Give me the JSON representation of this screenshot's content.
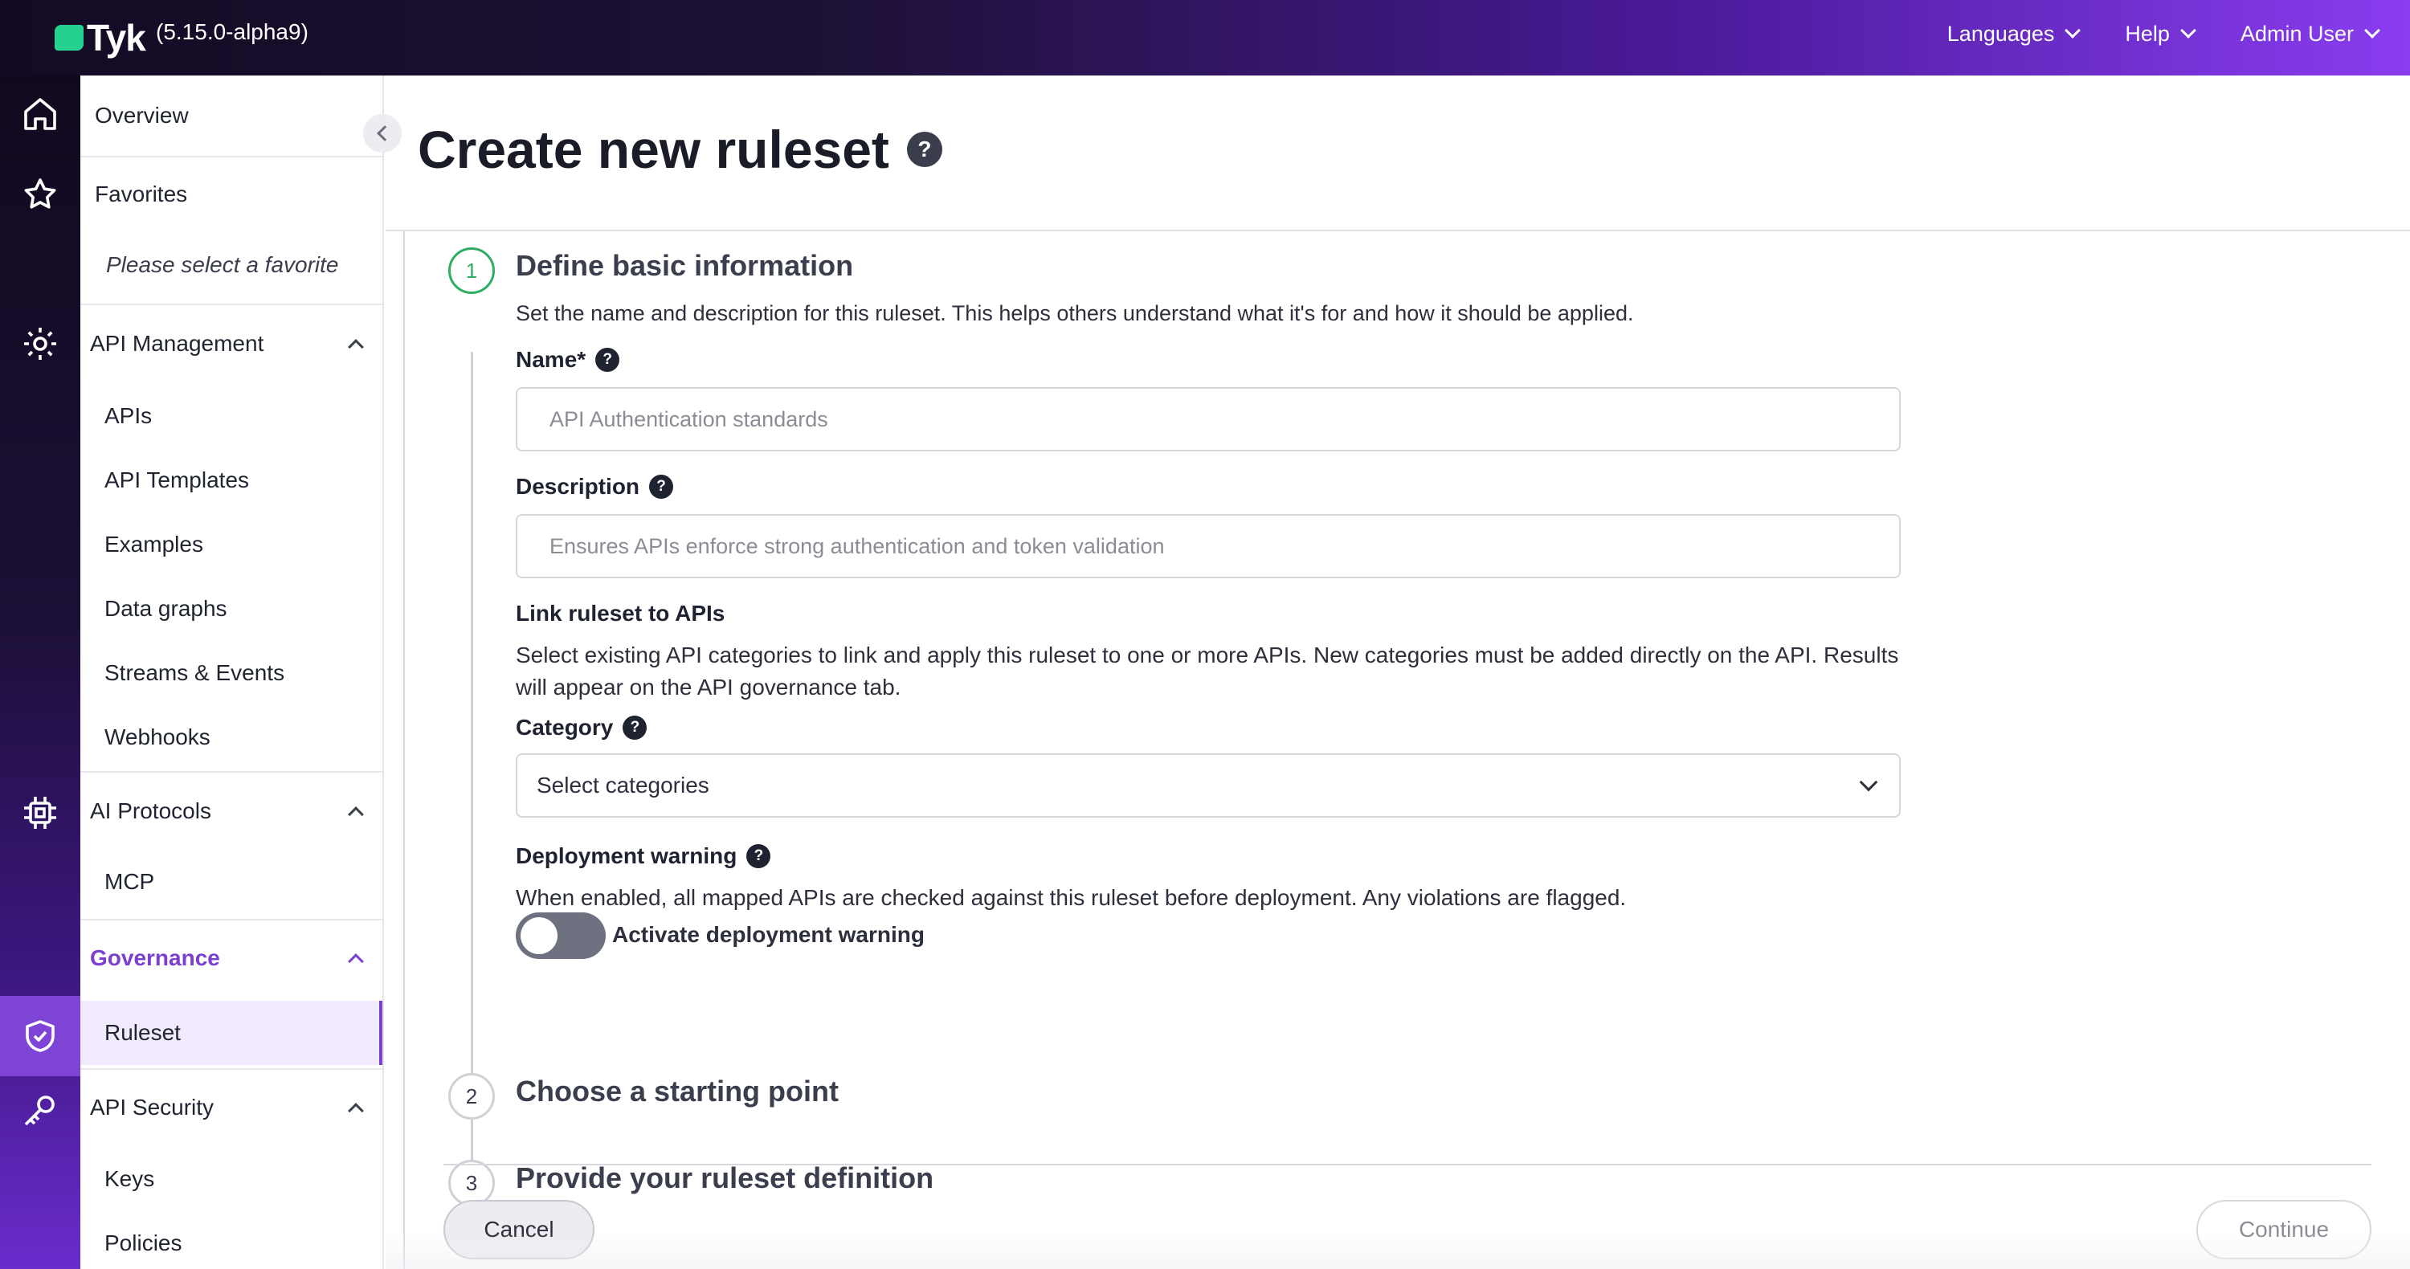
{
  "header": {
    "logo_text": "Tyk",
    "version": "(5.15.0-alpha9)",
    "nav": [
      {
        "label": "Languages"
      },
      {
        "label": "Help"
      },
      {
        "label": "Admin User"
      }
    ]
  },
  "rail": {
    "icons": [
      "home-icon",
      "star-icon",
      "api-gear-icon",
      "chip-icon",
      "shield-check-icon",
      "key-icon"
    ]
  },
  "sidebar": {
    "overview": "Overview",
    "favorites": "Favorites",
    "favorites_placeholder": "Please select a favorite",
    "api_management": {
      "label": "API Management",
      "items": [
        "APIs",
        "API Templates",
        "Examples",
        "Data graphs",
        "Streams & Events",
        "Webhooks"
      ]
    },
    "ai_protocols": {
      "label": "AI Protocols",
      "items": [
        "MCP"
      ]
    },
    "governance": {
      "label": "Governance",
      "items": [
        "Ruleset"
      ]
    },
    "api_security": {
      "label": "API Security",
      "items": [
        "Keys",
        "Policies"
      ]
    }
  },
  "page": {
    "title": "Create new ruleset",
    "help_glyph": "?",
    "steps": [
      {
        "number": "1",
        "title": "Define basic information"
      },
      {
        "number": "2",
        "title": "Choose a starting point"
      },
      {
        "number": "3",
        "title": "Provide your ruleset definition"
      }
    ],
    "step1": {
      "intro": "Set the name and description for this ruleset. This helps others understand what it's for and how it should be applied.",
      "name_label": "Name*",
      "name_placeholder": "API Authentication standards",
      "description_label": "Description",
      "description_placeholder": "Ensures APIs enforce strong authentication and token validation",
      "link_heading": "Link ruleset to APIs",
      "link_text": "Select existing API categories to link and apply this ruleset to one or more APIs. New categories must be added directly on the API. Results will appear on the API governance tab.",
      "category_label": "Category",
      "category_placeholder": "Select categories",
      "deployment_label": "Deployment warning",
      "deployment_text": "When enabled, all mapped APIs are checked against this ruleset before deployment. Any violations are flagged.",
      "toggle_label": "Activate deployment warning",
      "toggle_on": false
    },
    "buttons": {
      "cancel": "Cancel",
      "continue": "Continue"
    }
  },
  "colors": {
    "accent": "#7b3fd1",
    "step_active": "#2fae63",
    "logo_mark": "#24d18e"
  }
}
